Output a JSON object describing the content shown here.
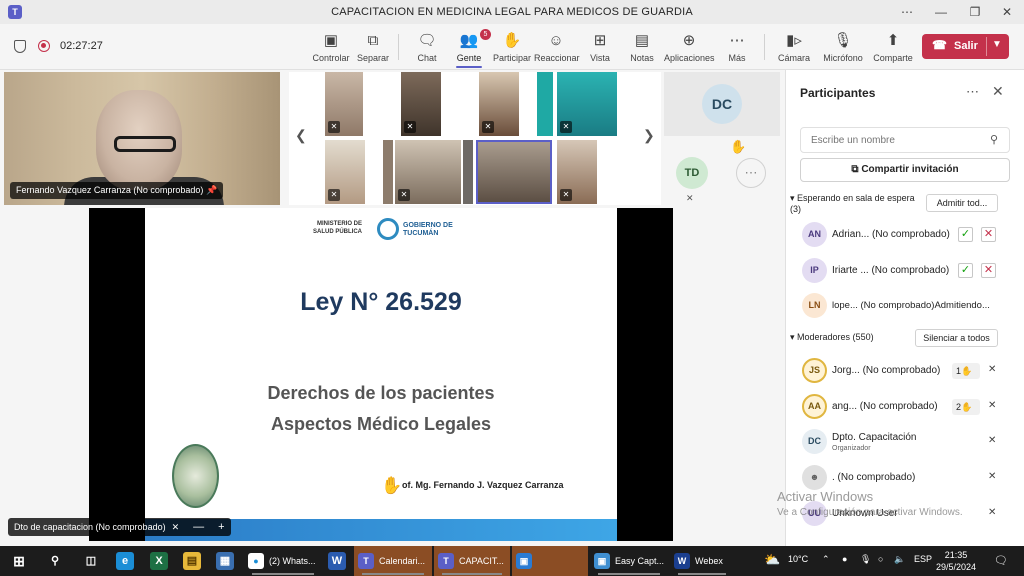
{
  "window": {
    "title": "CAPACITACION EN MEDICINA LEGAL PARA MEDICOS DE GUARDIA",
    "logo": "T",
    "min": "⋯",
    "minimize": "—",
    "restore": "❐",
    "close": "✕"
  },
  "meeting": {
    "timer": "02:27:27"
  },
  "toolbar": {
    "controlar": "Controlar",
    "separar": "Separar",
    "chat": "Chat",
    "gente": "Gente",
    "gente_badge": "5",
    "participar": "Participar",
    "reaccionar": "Reaccionar",
    "vista": "Vista",
    "notas": "Notas",
    "aplicaciones": "Aplicaciones",
    "mas": "Más",
    "camara": "Cámara",
    "microfono": "Micrófono",
    "comparte": "Comparte",
    "salir": "Salir"
  },
  "stage": {
    "speaker_name": "Fernando Vazquez Carranza (No comprobado)",
    "dc_initials": "DC",
    "td_initials": "TD"
  },
  "slide": {
    "ministry": "MINISTERIO DE\nSALUD PÚBLICA",
    "gov": "GOBIERNO DE\nTUCUMÁN",
    "title": "Ley N° 26.529",
    "sub1": "Derechos de los pacientes",
    "sub2": "Aspectos Médico Legales",
    "author": "of. Mg. Fernando J. Vazquez Carranza"
  },
  "share_chip": {
    "label": "Dto de capacitacion (No comprobado)",
    "zoom_out": "—",
    "zoom_in": "+"
  },
  "panel": {
    "title": "Participantes",
    "search_placeholder": "Escribe un nombre",
    "share_invite": "Compartir invitación",
    "waiting_header": "Esperando en sala de espera\n(3)",
    "admit_all": "Admitir tod...",
    "waiting": [
      {
        "initials": "AN",
        "name": "Adrian... (No comprobado)"
      },
      {
        "initials": "IP",
        "name": "Iriarte ... (No comprobado)"
      },
      {
        "initials": "LN",
        "name": "lope... (No comprobado)Admitiendo..."
      }
    ],
    "moderators_header": "Moderadores (550)",
    "mute_all": "Silenciar a todos",
    "moderators": [
      {
        "initials": "JS",
        "name": "Jorg... (No comprobado)",
        "hand": "1"
      },
      {
        "initials": "AA",
        "name": "ang... (No comprobado)",
        "hand": "2"
      },
      {
        "initials": "DC",
        "name": "Dpto. Capacitación",
        "sub": "Organizador"
      },
      {
        "initials": "",
        "name": ". (No comprobado)"
      },
      {
        "initials": "UU",
        "name": "Unknown User"
      }
    ]
  },
  "watermark": {
    "line1": "Activar Windows",
    "line2": "Ve a Configuración para activar Windows."
  },
  "taskbar": {
    "apps": [
      {
        "label": "(2) Whats..."
      },
      {
        "label": "Calendari..."
      },
      {
        "label": "CAPACIT..."
      },
      {
        "label": "Easy Capt..."
      },
      {
        "label": "Webex"
      }
    ],
    "weather": "10°C",
    "lang": "ESP",
    "time": "21:35",
    "date": "29/5/2024"
  },
  "colors": {
    "accent": "#5b5fc7",
    "leave": "#c4314b",
    "slide_title": "#1f3a5f"
  }
}
